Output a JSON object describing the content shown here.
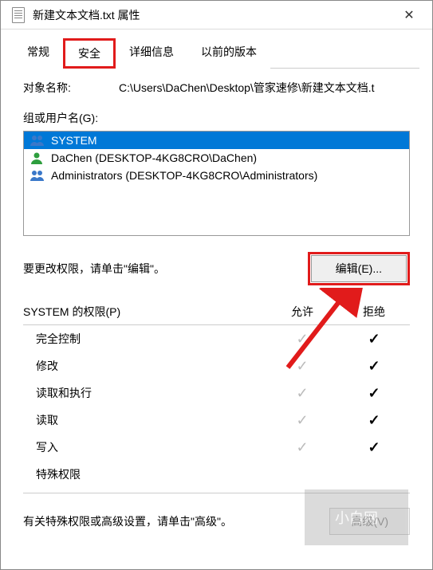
{
  "title": "新建文本文档.txt 属性",
  "tabs": [
    "常规",
    "安全",
    "详细信息",
    "以前的版本"
  ],
  "objectName": {
    "label": "对象名称:",
    "value": "C:\\Users\\DaChen\\Desktop\\管家速修\\新建文本文档.t"
  },
  "groupLabel": "组或用户名(G):",
  "users": [
    {
      "name": "SYSTEM",
      "selected": true,
      "iconColor": "#3a78c9",
      "type": "group"
    },
    {
      "name": "DaChen (DESKTOP-4KG8CRO\\DaChen)",
      "selected": false,
      "iconColor": "#2e9e3e",
      "type": "user"
    },
    {
      "name": "Administrators (DESKTOP-4KG8CRO\\Administrators)",
      "selected": false,
      "iconColor": "#3a78c9",
      "type": "group"
    }
  ],
  "editHint": "要更改权限，请单击\"编辑\"。",
  "editButton": "编辑(E)...",
  "permHeader": {
    "title": "SYSTEM 的权限(P)",
    "allow": "允许",
    "deny": "拒绝"
  },
  "permissions": [
    {
      "name": "完全控制",
      "allow": true,
      "deny": true
    },
    {
      "name": "修改",
      "allow": true,
      "deny": true
    },
    {
      "name": "读取和执行",
      "allow": true,
      "deny": true
    },
    {
      "name": "读取",
      "allow": true,
      "deny": true
    },
    {
      "name": "写入",
      "allow": true,
      "deny": true
    },
    {
      "name": "特殊权限",
      "allow": false,
      "deny": false
    }
  ],
  "advHint": "有关特殊权限或高级设置，请单击\"高级\"。",
  "advButton": "高级(V)",
  "watermark": "小白网"
}
